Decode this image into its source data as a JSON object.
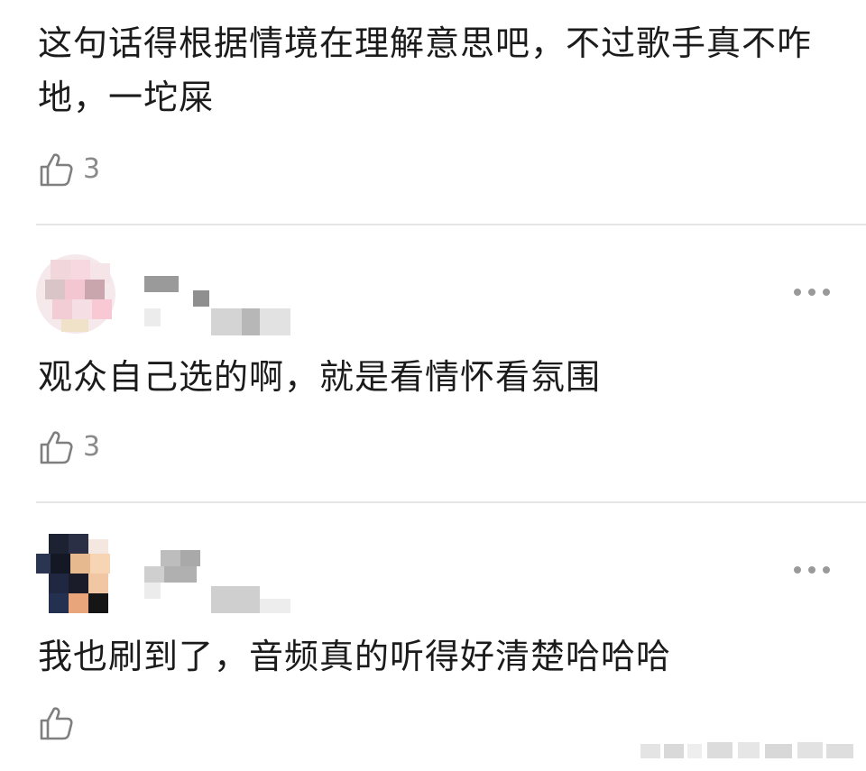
{
  "comments": [
    {
      "text": "这句话得根据情境在理解意思吧，不过歌手真不咋地，一坨屎",
      "likes": "3"
    },
    {
      "text": "观众自己选的啊，就是看情怀看氛围",
      "likes": "3"
    },
    {
      "text": "我也刷到了，音频真的听得好清楚哈哈哈",
      "likes": ""
    }
  ],
  "colors": {
    "text": "#1b1b1b",
    "muted": "#8a8a8a",
    "divider": "#e6e6e6"
  },
  "icons": {
    "like": "thumbs-up-icon",
    "more": "more-dots-icon"
  }
}
